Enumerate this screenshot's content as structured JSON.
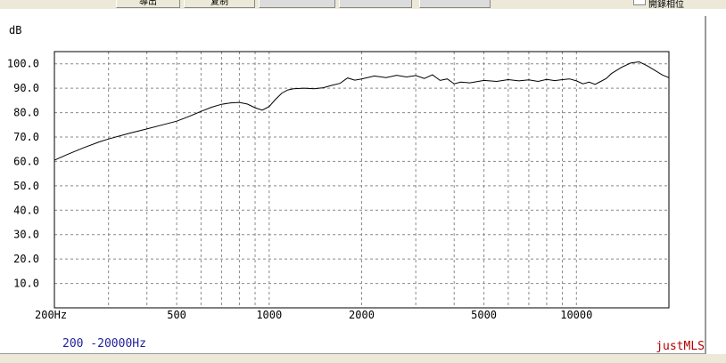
{
  "toolbar": {
    "buttons": [
      "導出",
      "复制",
      "",
      "",
      ""
    ],
    "checkbox_label": "開錄相位"
  },
  "chart_data": {
    "type": "line",
    "ylabel": "dB",
    "xscale": "log",
    "xlim": [
      200,
      20000
    ],
    "ylim": [
      0,
      105
    ],
    "yticks": [
      "100.0",
      "90.0",
      "80.0",
      "70.0",
      "60.0",
      "50.0",
      "40.0",
      "30.0",
      "20.0",
      "10.0"
    ],
    "xticks": [
      "200Hz",
      "500",
      "1000",
      "2000",
      "5000",
      "10000"
    ],
    "grid": true,
    "range_label": "200 -20000Hz",
    "brand": "justMLS",
    "series": [
      {
        "color": "#000000",
        "x": [
          200,
          220,
          250,
          280,
          300,
          350,
          400,
          450,
          500,
          550,
          600,
          650,
          700,
          750,
          800,
          850,
          900,
          950,
          1000,
          1050,
          1100,
          1150,
          1200,
          1300,
          1400,
          1500,
          1600,
          1700,
          1800,
          1900,
          2000,
          2200,
          2400,
          2600,
          2800,
          3000,
          3200,
          3400,
          3600,
          3800,
          4000,
          4200,
          4500,
          5000,
          5500,
          6000,
          6500,
          7000,
          7500,
          8000,
          8500,
          9000,
          9500,
          10000,
          10500,
          11000,
          11500,
          12000,
          12500,
          13000,
          14000,
          15000,
          16000,
          17000,
          18000,
          19000,
          20000
        ],
        "y": [
          60.5,
          62.8,
          65.7,
          68.0,
          69.2,
          71.5,
          73.3,
          75.0,
          76.5,
          78.5,
          80.5,
          82.2,
          83.4,
          84.0,
          84.2,
          83.5,
          82.0,
          81.0,
          82.5,
          85.5,
          88.0,
          89.3,
          89.8,
          90.0,
          89.8,
          90.2,
          91.2,
          92.0,
          94.2,
          93.3,
          93.8,
          95.0,
          94.3,
          95.3,
          94.6,
          95.2,
          94.0,
          95.5,
          93.2,
          93.8,
          91.8,
          92.5,
          92.2,
          93.2,
          92.8,
          93.5,
          93.0,
          93.4,
          92.8,
          93.6,
          93.1,
          93.5,
          93.8,
          93.0,
          91.8,
          92.5,
          91.6,
          92.8,
          94.0,
          96.0,
          98.5,
          100.3,
          100.8,
          99.2,
          97.3,
          95.5,
          94.3
        ]
      }
    ]
  }
}
